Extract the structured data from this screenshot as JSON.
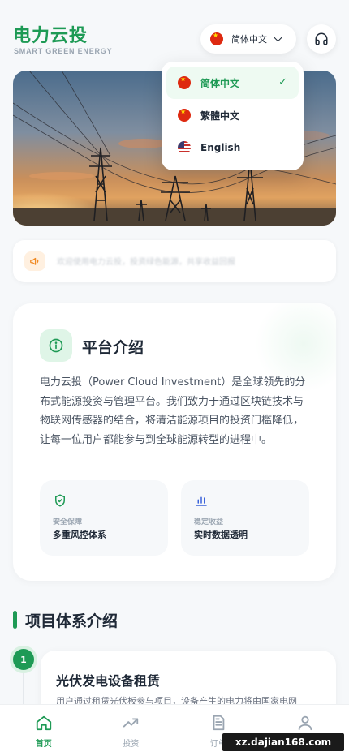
{
  "brand": {
    "title": "电力云投",
    "subtitle": "SMART GREEN ENERGY"
  },
  "header": {
    "language_button": {
      "label": "简体中文",
      "flag_icon": "cn-flag-icon"
    },
    "support_icon": "headphones-icon"
  },
  "language_menu": {
    "items": [
      {
        "label": "简体中文",
        "flag_icon": "cn-flag-icon",
        "selected": true
      },
      {
        "label": "繁體中文",
        "flag_icon": "cn-flag-icon",
        "selected": false
      },
      {
        "label": "English",
        "flag_icon": "us-flag-icon",
        "selected": false
      }
    ],
    "check_mark": "✓"
  },
  "hero": {
    "image": "power-transmission-towers-at-sunset"
  },
  "notice": {
    "icon": "megaphone-icon",
    "text": "欢迎使用电力云投，投资绿色能源，共享收益回报"
  },
  "platform_intro": {
    "title": "平台介绍",
    "description": "电力云投（Power Cloud Investment）是全球领先的分布式能源投资与管理平台。我们致力于通过区块链技术与物联网传感器的结合，将清洁能源项目的投资门槛降低，让每一位用户都能参与到全球能源转型的进程中。",
    "features": [
      {
        "icon": "shield-check-icon",
        "small": "安全保障",
        "big": "多重风控体系"
      },
      {
        "icon": "bar-chart-icon",
        "small": "稳定收益",
        "big": "实时数据透明"
      }
    ]
  },
  "project_section": {
    "title": "项目体系介绍",
    "projects": [
      {
        "step": "1",
        "title": "光伏发电设备租赁",
        "description": "用户通过租赁光伏板参与项目，设备产生的电力将由国家电网"
      }
    ]
  },
  "tabbar": {
    "items": [
      {
        "label": "首页",
        "icon": "home-icon",
        "active": true
      },
      {
        "label": "投资",
        "icon": "trending-up-icon",
        "active": false
      },
      {
        "label": "订单",
        "icon": "document-icon",
        "active": false
      },
      {
        "label": "我的",
        "icon": "user-icon",
        "active": false
      }
    ]
  },
  "watermark": "xz.dajian168.com",
  "colors": {
    "accent": "#1e9a55",
    "background": "#f6f8fa",
    "text": "#1f2937"
  }
}
